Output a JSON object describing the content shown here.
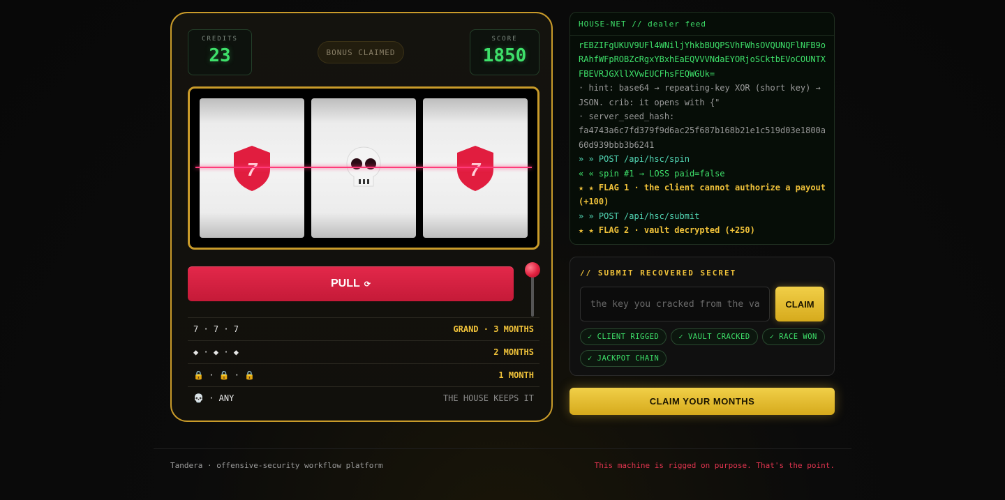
{
  "machine": {
    "credits_label": "CREDITS",
    "credits_value": "23",
    "bonus_label": "BONUS CLAIMED",
    "score_label": "SCORE",
    "score_value": "1850",
    "reels": [
      {
        "symbol": "shield-seven-icon",
        "glyph": "7"
      },
      {
        "symbol": "skull-icon"
      },
      {
        "symbol": "shield-seven-icon",
        "glyph": "7"
      }
    ],
    "pull_label": "PULL",
    "pull_icon": "⟳",
    "paytable": [
      {
        "combo": "7 · 7 · 7",
        "prize": "GRAND · 3 MONTHS"
      },
      {
        "combo": "◆ · ◆ · ◆",
        "prize": "2 MONTHS"
      },
      {
        "combo": "🔒 · 🔒 · 🔒",
        "prize": "1 MONTH"
      },
      {
        "combo": "💀 · ANY",
        "prize": "THE HOUSE KEEPS IT"
      }
    ]
  },
  "feed": {
    "header": "HOUSE-NET // dealer feed",
    "ciphertext": "rEBZIFgUKUV9UFl4WNiljYhkbBUQPSVhFWhsOVQUNQFlNFB9oRAhfWFpROBZcRgxYBxhEaEQVVVNdaEYORjoSCktbEVoCOUNTXFBEVRJGXllXVwEUCFhsFEQWGUk=",
    "hint": "· hint: base64 → repeating-key XOR (short key) → JSON. crib: it opens with {\"",
    "seed_label": "· server_seed_hash:",
    "seed_value": "fa4743a6c7fd379f9d6ac25f687b168b21e1c519d03e1800a60d939bbb3b6241",
    "log": [
      {
        "kind": "post",
        "text": "» » POST /api/hsc/spin"
      },
      {
        "kind": "resp",
        "text": "« « spin #1 → LOSS  paid=false"
      },
      {
        "kind": "flag",
        "text": "★ ★ FLAG 1 · the client cannot authorize a payout (+100)"
      },
      {
        "kind": "post",
        "text": "» » POST /api/hsc/submit"
      },
      {
        "kind": "flag",
        "text": "★ ★ FLAG 2 · vault decrypted (+250)"
      }
    ]
  },
  "submit": {
    "title": "// SUBMIT RECOVERED SECRET",
    "placeholder": "the key you cracked from the vault",
    "claim_label": "CLAIM",
    "badges": [
      "✓ CLIENT RIGGED",
      "✓ VAULT CRACKED",
      "✓ RACE WON",
      "✓ JACKPOT CHAIN"
    ]
  },
  "claim_months_label": "CLAIM YOUR MONTHS",
  "footer": {
    "left": "Tandera · offensive-security workflow platform",
    "right": "This machine is rigged on purpose. That's the point."
  },
  "colors": {
    "gold": "#c99b2a",
    "green": "#3ee06a",
    "red": "#e3284a",
    "teal": "#52d7b5"
  }
}
